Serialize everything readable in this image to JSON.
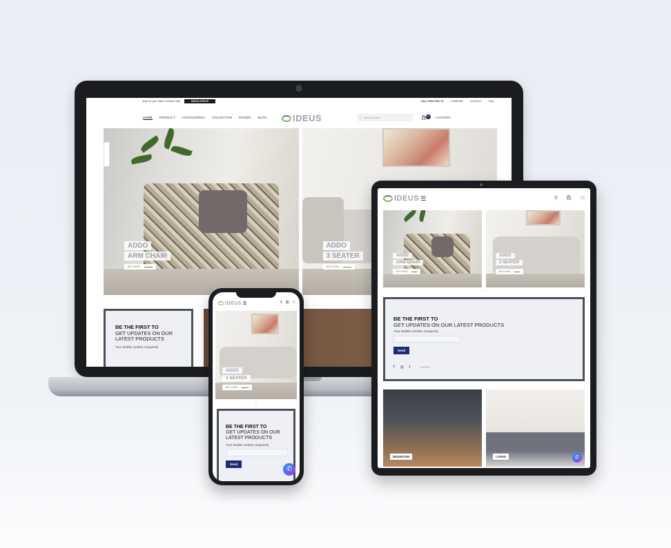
{
  "site": {
    "brand": "IDEUS"
  },
  "topbar": {
    "promo_text": "Shop for your Office Furniture Visit",
    "office_badge": "IDEUS OFFICE",
    "call": "CALL 0000 0000 TU",
    "links": [
      "COMPARE",
      "CONTACT",
      "FAQ"
    ]
  },
  "nav": {
    "links": [
      "HOME",
      "PRODUCT",
      "ACCESSORIES",
      "COLLECTION",
      "ROOMS",
      "BLOG"
    ],
    "search_placeholder": "Search product",
    "cart_count": "0",
    "account": "ACCOUNT"
  },
  "heroes": [
    {
      "line1": "ADDO",
      "line2": "ARM CHAIR",
      "cta": "BUY NOW"
    },
    {
      "line1": "ADDO",
      "line2": "3 SEATER",
      "cta": "BUY NOW"
    }
  ],
  "newsletter": {
    "heading_bold": "BE THE FIRST TO",
    "heading_rest": "GET UPDATES ON OUR LATEST PRODUCTS",
    "heading_rest_line1": "GET UPDATES ON OUR",
    "heading_rest_line2": "LATEST PRODUCTS",
    "mobile_label": "Your Mobile number (required)",
    "send_label": "Send"
  },
  "socials": [
    "f",
    "◎",
    "t"
  ],
  "rooms": [
    {
      "label": "BEDROOM"
    },
    {
      "label": "LIVING"
    }
  ],
  "colors": {
    "brand_navy": "#1c2a78",
    "frame": "#1b1c20",
    "newsletter_border": "#4a4f58",
    "label_text": "#9a9da6"
  },
  "icons": {
    "search": "search-icon",
    "cart": "cart-icon",
    "account": "user-icon",
    "menu": "hamburger-icon",
    "messenger": "messenger-icon"
  }
}
